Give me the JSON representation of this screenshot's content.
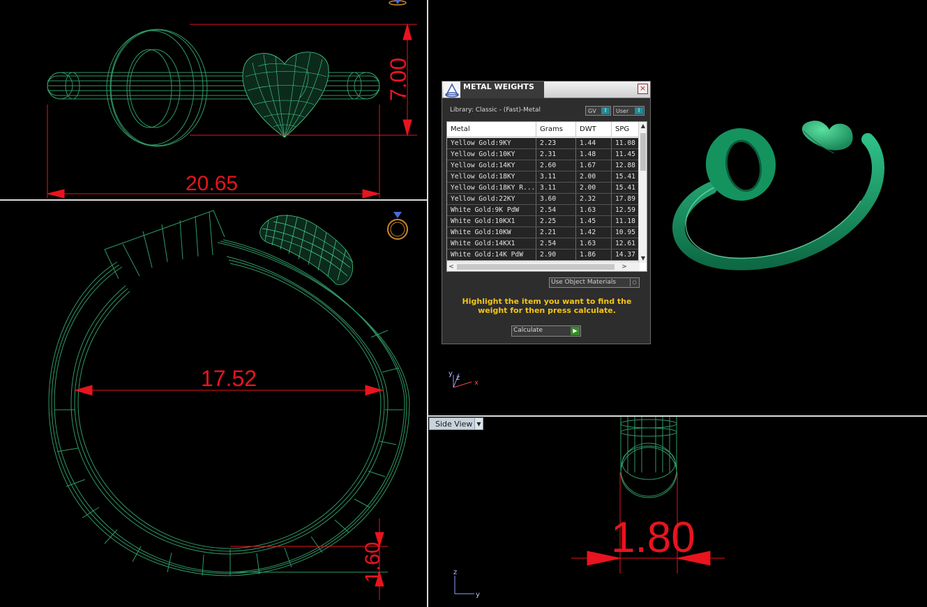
{
  "viewports": {
    "top": {
      "dim_width": "20.65",
      "dim_height": "7.00"
    },
    "front": {
      "dim_diameter": "17.52",
      "dim_thickness": "1.60"
    },
    "side": {
      "label": "Side View",
      "dim_width": "1.80",
      "axis_z": "z",
      "axis_y": "y"
    },
    "perspective": {
      "axis_y": "y",
      "axis_z": "z",
      "axis_x": "x"
    }
  },
  "panel": {
    "title": "METAL WEIGHTS",
    "close_icon": "×",
    "library": "Library: Classic - (Fast)-Metal",
    "toggle_gv": "GV",
    "toggle_user": "User",
    "toggle_indicator": "I",
    "columns": [
      "Metal",
      "Grams",
      "DWT",
      "SPG"
    ],
    "rows": [
      [
        "Yellow Gold:9KY",
        "2.23",
        "1.44",
        "11.08"
      ],
      [
        "Yellow Gold:10KY",
        "2.31",
        "1.48",
        "11.45"
      ],
      [
        "Yellow Gold:14KY",
        "2.60",
        "1.67",
        "12.88"
      ],
      [
        "Yellow Gold:18KY",
        "3.11",
        "2.00",
        "15.41"
      ],
      [
        "Yellow Gold:18KY R...",
        "3.11",
        "2.00",
        "15.41"
      ],
      [
        "Yellow Gold:22KY",
        "3.60",
        "2.32",
        "17.89"
      ],
      [
        "White Gold:9K PdW",
        "2.54",
        "1.63",
        "12.59"
      ],
      [
        "White Gold:10KX1",
        "2.25",
        "1.45",
        "11.18"
      ],
      [
        "White Gold:10KW",
        "2.21",
        "1.42",
        "10.95"
      ],
      [
        "White Gold:14KX1",
        "2.54",
        "1.63",
        "12.61"
      ],
      [
        "White Gold:14K PdW",
        "2.90",
        "1.86",
        "14.37"
      ]
    ],
    "scroll_up": "▲",
    "scroll_down": "▼",
    "scroll_left": "<",
    "scroll_right": ">",
    "materials_select": "Use Object Materials",
    "instruction": "Highlight the item you want to find the weight for then press calculate.",
    "calculate_label": "Calculate"
  },
  "colors": {
    "wire": "#3cc886",
    "dimension": "#e8141e",
    "solid": "#1d9a68"
  }
}
